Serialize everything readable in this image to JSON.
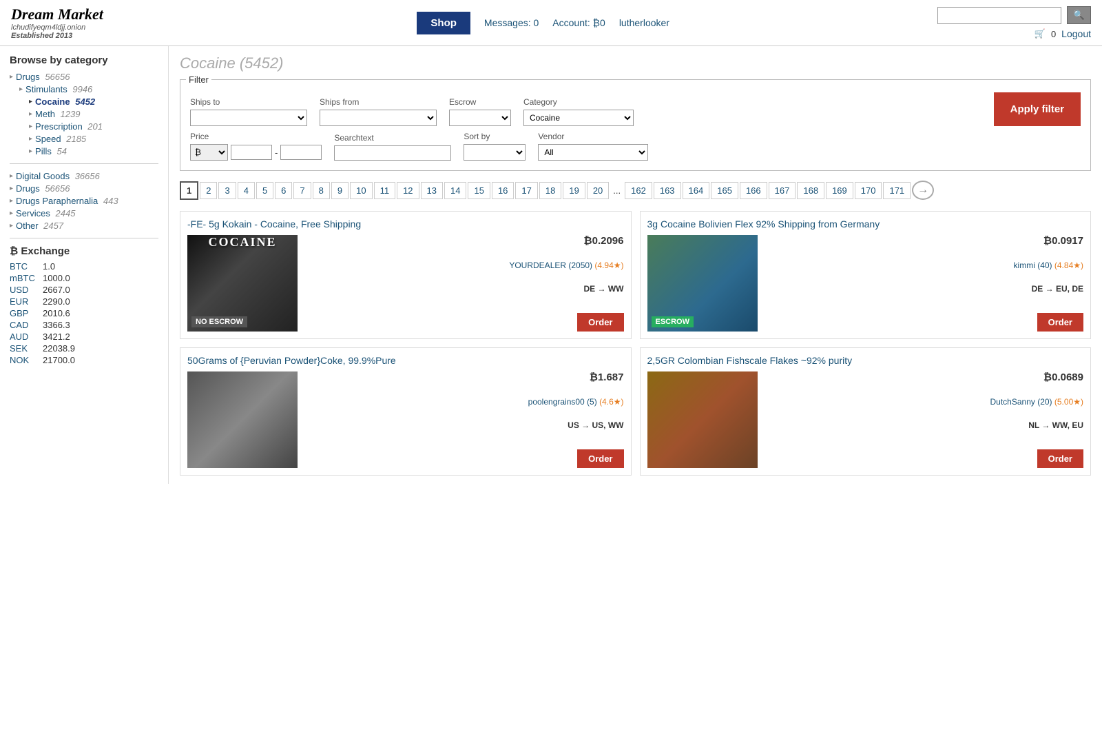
{
  "site": {
    "name": "Dream Market",
    "domain": "lchudifyeqm4ldjj.onion",
    "established": "Established 2013"
  },
  "header": {
    "shop_label": "Shop",
    "messages_label": "Messages: 0",
    "account_label": "Account: ₿0",
    "username": "lutherlooker",
    "cart_count": "0",
    "logout_label": "Logout",
    "search_placeholder": ""
  },
  "sidebar": {
    "browse_title": "Browse by category",
    "categories": [
      {
        "name": "Drugs",
        "count": "56656",
        "level": 0,
        "active": false
      },
      {
        "name": "Stimulants",
        "count": "9946",
        "level": 1,
        "active": false
      },
      {
        "name": "Cocaine",
        "count": "5452",
        "level": 2,
        "active": true
      },
      {
        "name": "Meth",
        "count": "1239",
        "level": 2,
        "active": false
      },
      {
        "name": "Prescription",
        "count": "201",
        "level": 2,
        "active": false
      },
      {
        "name": "Speed",
        "count": "2185",
        "level": 2,
        "active": false
      },
      {
        "name": "Pills",
        "count": "54",
        "level": 2,
        "active": false
      }
    ],
    "other_categories": [
      {
        "name": "Digital Goods",
        "count": "36656"
      },
      {
        "name": "Drugs",
        "count": "56656"
      },
      {
        "name": "Drugs Paraphernalia",
        "count": "443"
      },
      {
        "name": "Services",
        "count": "2445"
      },
      {
        "name": "Other",
        "count": "2457"
      }
    ],
    "exchange_title": "₿ Exchange",
    "exchange_rates": [
      {
        "currency": "BTC",
        "value": "1.0"
      },
      {
        "currency": "mBTC",
        "value": "1000.0"
      },
      {
        "currency": "USD",
        "value": "2667.0"
      },
      {
        "currency": "EUR",
        "value": "2290.0"
      },
      {
        "currency": "GBP",
        "value": "2010.6"
      },
      {
        "currency": "CAD",
        "value": "3366.3"
      },
      {
        "currency": "AUD",
        "value": "3421.2"
      },
      {
        "currency": "SEK",
        "value": "22038.9"
      },
      {
        "currency": "NOK",
        "value": "21700.0"
      }
    ]
  },
  "page": {
    "title": "Cocaine (5452)"
  },
  "filter": {
    "legend": "Filter",
    "ships_to_label": "Ships to",
    "ships_from_label": "Ships from",
    "escrow_label": "Escrow",
    "category_label": "Category",
    "category_value": "Cocaine",
    "price_label": "Price",
    "price_currency": "₿",
    "searchtext_label": "Searchtext",
    "sort_by_label": "Sort by",
    "vendor_label": "Vendor",
    "vendor_value": "All",
    "apply_label": "Apply filter"
  },
  "pagination": {
    "pages": [
      "1",
      "2",
      "3",
      "4",
      "5",
      "6",
      "7",
      "8",
      "9",
      "10",
      "11",
      "12",
      "13",
      "14",
      "15",
      "16",
      "17",
      "18",
      "19",
      "20",
      "...",
      "162",
      "163",
      "164",
      "165",
      "166",
      "167",
      "168",
      "169",
      "170",
      "171"
    ],
    "current": "1",
    "next_label": "→"
  },
  "products": [
    {
      "id": "p1",
      "title": "-FE- 5g Kokain - Cocaine, Free Shipping",
      "price": "₿0.2096",
      "vendor": "YOURDEALER (2050)",
      "rating": "4.94",
      "shipping": "DE → WW",
      "escrow": "NO ESCROW",
      "escrow_type": "none",
      "img_type": "cocaine"
    },
    {
      "id": "p2",
      "title": "3g Cocaine Bolivien Flex 92% Shipping from Germany",
      "price": "₿0.0917",
      "vendor": "kimmi (40)",
      "rating": "4.84",
      "shipping": "DE → EU, DE",
      "escrow": "ESCROW",
      "escrow_type": "escrow",
      "img_type": "rock"
    },
    {
      "id": "p3",
      "title": "50Grams of {Peruvian Powder}Coke, 99.9%Pure",
      "price": "₿1.687",
      "vendor": "poolengrains00 (5)",
      "rating": "4.6",
      "shipping": "US → US, WW",
      "escrow": "",
      "escrow_type": "none",
      "img_type": "powder"
    },
    {
      "id": "p4",
      "title": "2,5GR Colombian Fishscale Flakes ~92% purity",
      "price": "₿0.0689",
      "vendor": "DutchSanny (20)",
      "rating": "5.00",
      "shipping": "NL → WW, EU",
      "escrow": "",
      "escrow_type": "none",
      "img_type": "gecko"
    }
  ]
}
